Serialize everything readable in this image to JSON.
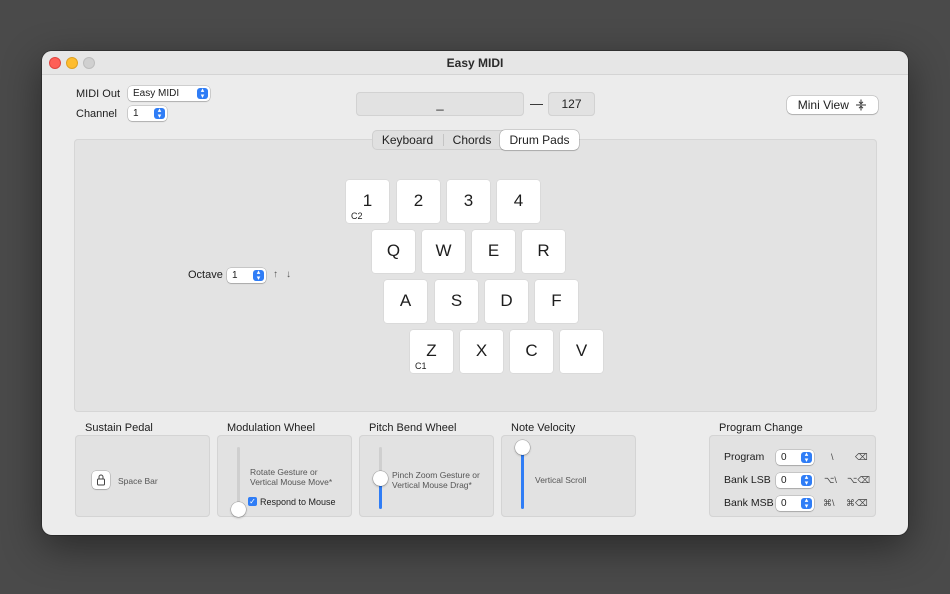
{
  "window": {
    "title": "Easy MIDI"
  },
  "header": {
    "midi_out_label": "MIDI Out",
    "midi_out_value": "Easy MIDI",
    "channel_label": "Channel",
    "channel_value": "1",
    "note_display": "_",
    "range_dash": "—",
    "velocity_display": "127",
    "mini_view_label": "Mini View",
    "mini_view_icon": "split-vertical-icon"
  },
  "tabs": [
    {
      "label": "Keyboard",
      "selected": false
    },
    {
      "label": "Chords",
      "selected": false
    },
    {
      "label": "Drum Pads",
      "selected": true
    }
  ],
  "octave": {
    "label": "Octave",
    "value": "1",
    "up_arrow": "↑",
    "down_arrow": "↓"
  },
  "pads": {
    "row1": [
      {
        "key": "1",
        "note": "C2"
      },
      {
        "key": "2",
        "note": ""
      },
      {
        "key": "3",
        "note": ""
      },
      {
        "key": "4",
        "note": ""
      }
    ],
    "row2": [
      {
        "key": "Q",
        "note": ""
      },
      {
        "key": "W",
        "note": ""
      },
      {
        "key": "E",
        "note": ""
      },
      {
        "key": "R",
        "note": ""
      }
    ],
    "row3": [
      {
        "key": "A",
        "note": ""
      },
      {
        "key": "S",
        "note": ""
      },
      {
        "key": "D",
        "note": ""
      },
      {
        "key": "F",
        "note": ""
      }
    ],
    "row4": [
      {
        "key": "Z",
        "note": "C1"
      },
      {
        "key": "X",
        "note": ""
      },
      {
        "key": "C",
        "note": ""
      },
      {
        "key": "V",
        "note": ""
      }
    ]
  },
  "sustain": {
    "title": "Sustain Pedal",
    "hint": "Space Bar",
    "icon": "lock-icon"
  },
  "modulation": {
    "title": "Modulation Wheel",
    "hint_line1": "Rotate Gesture or",
    "hint_line2": "Vertical Mouse Move*",
    "checkbox_label": "Respond to Mouse",
    "checked": true,
    "level": 0.0
  },
  "pitch_bend": {
    "title": "Pitch Bend Wheel",
    "hint_line1": "Pinch Zoom Gesture or",
    "hint_line2": "Vertical Mouse Drag*",
    "level": 0.5
  },
  "velocity": {
    "title": "Note Velocity",
    "hint": "Vertical Scroll",
    "level": 1.0
  },
  "program_change": {
    "title": "Program Change",
    "rows": [
      {
        "label": "Program",
        "value": "0",
        "shortcut1": "\\",
        "shortcut2": "⌫"
      },
      {
        "label": "Bank LSB",
        "value": "0",
        "shortcut1": "⌥\\",
        "shortcut2": "⌥⌫"
      },
      {
        "label": "Bank MSB",
        "value": "0",
        "shortcut1": "⌘\\",
        "shortcut2": "⌘⌫"
      }
    ]
  },
  "colors": {
    "accent": "#2f7df6",
    "window_bg": "#ececec",
    "desktop_bg": "#4a4a4a"
  }
}
